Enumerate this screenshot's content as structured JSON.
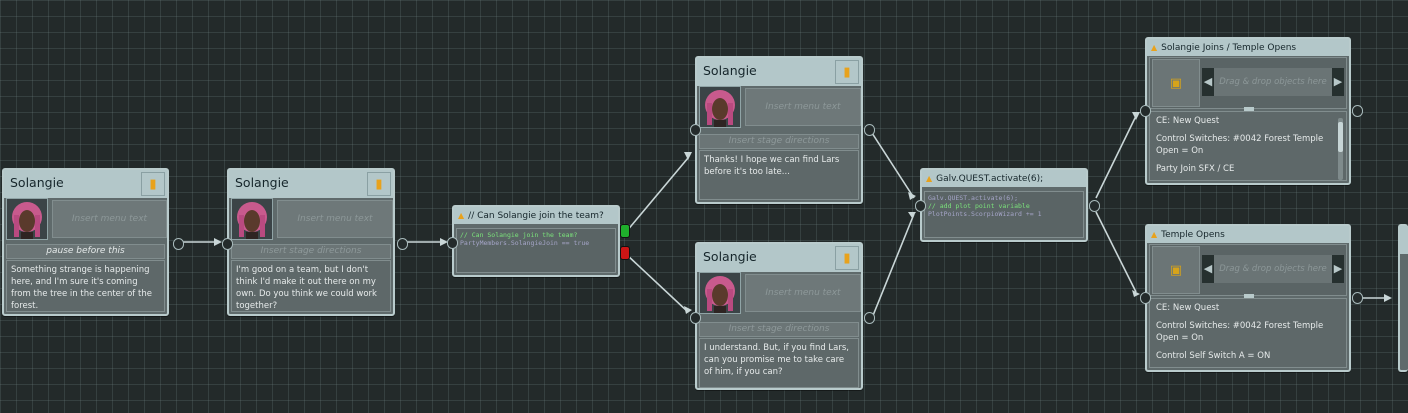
{
  "speaker": "Solangie",
  "menu_placeholder": "Insert menu text",
  "stage_placeholder": "Insert stage directions",
  "dropzone_placeholder": "Drag & drop objects here",
  "nodes": {
    "n1": {
      "stage": "pause before this",
      "text": "Something strange is happening here, and I'm sure it's coming from the tree in the center of the forest."
    },
    "n2": {
      "text": "I'm good on a team, but I don't think I'd make it out there on my own. Do you think we could work together?"
    },
    "cond": {
      "title": "// Can Solangie join the team?",
      "code_comment": "// Can Solangie join the team?",
      "code_expr": "PartyMembers.SolangieJoin == true"
    },
    "n3": {
      "text": "Thanks! I hope we can find Lars before it's too late..."
    },
    "n4": {
      "text": "I understand. But, if you find Lars, can you promise me to take care of him, if you can?"
    },
    "script": {
      "title": "Galv.QUEST.activate(6);",
      "line1": "Galv.QUEST.activate(6);",
      "line2": "// add plot point variable",
      "line3": "PlotPoints.ScorpioWizard += 1"
    },
    "ce1": {
      "title": "Solangie Joins / Temple Opens",
      "body": [
        "CE: New Quest",
        "",
        "Control Switches: #0042 Forest Temple Open = On",
        "",
        "Party Join SFX / CE"
      ]
    },
    "ce2": {
      "title": "Temple Opens",
      "body": [
        "CE: New Quest",
        "",
        "Control Switches: #0042 Forest Temple Open = On",
        "",
        "Control Self Switch A = ON"
      ]
    }
  },
  "colors": {
    "true_branch": "#1fae2c",
    "false_branch": "#cc1515",
    "accent": "#e8a21c"
  },
  "icons": {
    "speech": "speech-bubble-icon",
    "script": "script-icon",
    "common_event": "trophy-icon"
  }
}
